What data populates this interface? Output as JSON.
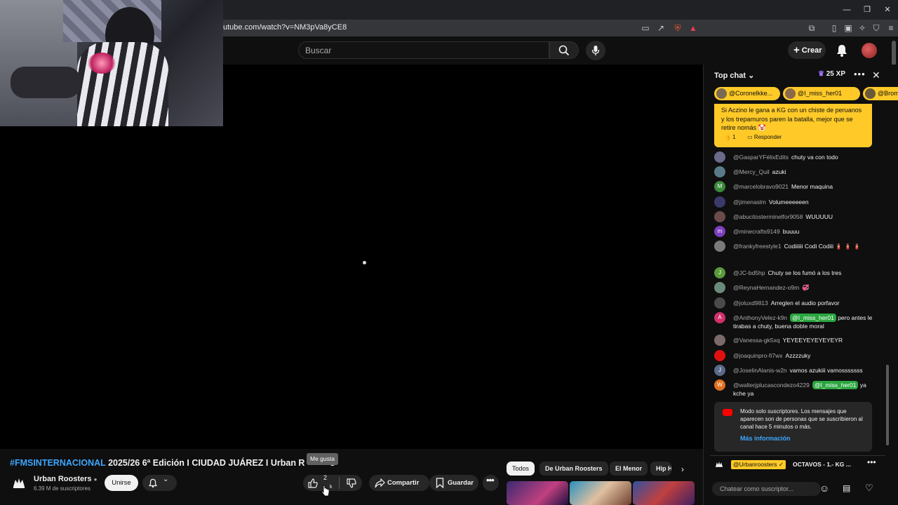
{
  "browser": {
    "url": "utube.com/watch?v=NM3pVa8yCE8"
  },
  "header": {
    "search_placeholder": "Buscar",
    "create_label": "Crear"
  },
  "video": {
    "title_tag": "#FMSINTERNACIONAL",
    "title_rest": " 2025/26 6ª Edición I CIUDAD JUÁREZ I Urban R",
    "title_tail": "s",
    "tooltip": "Me gusta",
    "channel": {
      "name": "Urban Roosters",
      "subscribers": "6.39 M de suscriptores",
      "join_label": "Unirse"
    },
    "actions": {
      "like_count": "2",
      "like_count_sub": "k",
      "share_label": "Compartir",
      "save_label": "Guardar"
    }
  },
  "related": {
    "chips": [
      "Todos",
      "De Urban Roosters",
      "El Menor",
      "Hip H"
    ]
  },
  "chat": {
    "title": "Top chat",
    "xp": "25 XP",
    "tickers": [
      {
        "label": "@Coronelkke..."
      },
      {
        "label": "@I_miss_her01"
      },
      {
        "label": "@Broma"
      }
    ],
    "pinned": {
      "text": "Si Aczino le gana a KG con un chiste de peruanos y los trepamuros paren la batalla, mejor que se retire nomás 🤡",
      "likes": "1",
      "reply_label": "Responder"
    },
    "messages": [
      {
        "user": "@GasparYFélixEdits",
        "text": "chuty va con todo",
        "avatar_letter": "",
        "avatar_color": "#6a6a8a"
      },
      {
        "user": "@Mercy_Quil",
        "text": "azuki",
        "avatar_letter": "",
        "avatar_color": "#5a7a8a"
      },
      {
        "user": "@marcelobravo9021",
        "text": "Menor maquina",
        "avatar_letter": "M",
        "avatar_color": "#3c8a3c"
      },
      {
        "user": "@jimenaslm",
        "text": "Volumeeeeeen",
        "avatar_letter": "",
        "avatar_color": "#3a3a6a"
      },
      {
        "user": "@abucitosterminelfor9058",
        "text": "WUUUUU",
        "avatar_letter": "",
        "avatar_color": "#6a4a4a"
      },
      {
        "user": "@minecrafts9149",
        "text": "buuuu",
        "avatar_letter": "m",
        "avatar_color": "#7b3fbf"
      },
      {
        "user": "@frankyfreestyle1",
        "text": "Codiiiiii Codi Codiii 🧯 🧯 🧯",
        "avatar_letter": "",
        "avatar_color": "#7a7a7a"
      },
      {
        "user": "@JC-bd5hp",
        "text": "Chuty se los fumó a los tres",
        "avatar_letter": "J",
        "avatar_color": "#5a9a3a"
      },
      {
        "user": "@ReynaHernandez-o9m",
        "text": "💞",
        "avatar_letter": "",
        "avatar_color": "#6a8a7a"
      },
      {
        "user": "@joluxd9813",
        "text": "Arreglen el audio porfavor",
        "avatar_letter": "",
        "avatar_color": "#4a4a4a"
      },
      {
        "user": "@AnthonyVelez-k9n",
        "mention": "@I_miss_her01",
        "text": "pero antes le tirabas a chuty, buena doble moral",
        "avatar_letter": "A",
        "avatar_color": "#d0306a"
      },
      {
        "user": "@Vanessa-gk5xq",
        "text": "YEYEEYEYEYEYEYR",
        "avatar_letter": "",
        "avatar_color": "#7a6a6a"
      },
      {
        "user": "@joaquinpro-fi7wx",
        "text": "Azzzzuky",
        "avatar_letter": "",
        "avatar_color": "#e01010"
      },
      {
        "user": "@JoselinAlanis-w2n",
        "text": "vamos azukiii vamosssssss",
        "avatar_letter": "J",
        "avatar_color": "#5a6a8a"
      },
      {
        "user": "@walterjplucascondezo4229",
        "mention": "@I_miss_her01",
        "text": "ya kche ya",
        "avatar_letter": "W",
        "avatar_color": "#e07020"
      }
    ],
    "notice": {
      "text": "Modo solo suscriptores. Los mensajes que aparecen son de personas que se suscribieron al canal hace 5 minutos o más.",
      "link": "Más información"
    },
    "channel_badge": "@Urbanroosters ✓",
    "channel_message": "OCTAVOS - 1.- KG ...",
    "input_placeholder": "Chatear como suscriptor..."
  }
}
